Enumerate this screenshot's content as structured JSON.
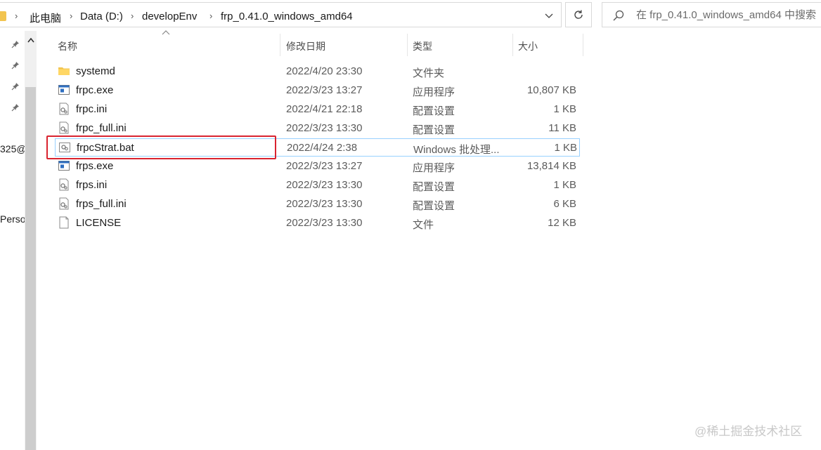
{
  "address": {
    "crumbs": [
      "此电脑",
      "Data (D:)",
      "developEnv",
      "frp_0.41.0_windows_amd64"
    ]
  },
  "search": {
    "placeholder": "在 frp_0.41.0_windows_amd64 中搜索"
  },
  "nav_pane": {
    "fragments": [
      "325@",
      "Perso"
    ]
  },
  "columns": {
    "name": "名称",
    "modified": "修改日期",
    "type": "类型",
    "size": "大小"
  },
  "files": [
    {
      "name": "systemd",
      "modified": "2022/4/20 23:30",
      "type": "文件夹",
      "size": "",
      "icon": "folder-icon"
    },
    {
      "name": "frpc.exe",
      "modified": "2022/3/23 13:27",
      "type": "应用程序",
      "size": "10,807 KB",
      "icon": "exe-icon"
    },
    {
      "name": "frpc.ini",
      "modified": "2022/4/21 22:18",
      "type": "配置设置",
      "size": "1 KB",
      "icon": "config-file-icon"
    },
    {
      "name": "frpc_full.ini",
      "modified": "2022/3/23 13:30",
      "type": "配置设置",
      "size": "11 KB",
      "icon": "config-file-icon"
    },
    {
      "name": "frpcStrat.bat",
      "modified": "2022/4/24 2:38",
      "type": "Windows 批处理...",
      "size": "1 KB",
      "icon": "batch-file-icon",
      "selected": true
    },
    {
      "name": "frps.exe",
      "modified": "2022/3/23 13:27",
      "type": "应用程序",
      "size": "13,814 KB",
      "icon": "exe-icon"
    },
    {
      "name": "frps.ini",
      "modified": "2022/3/23 13:30",
      "type": "配置设置",
      "size": "1 KB",
      "icon": "config-file-icon"
    },
    {
      "name": "frps_full.ini",
      "modified": "2022/3/23 13:30",
      "type": "配置设置",
      "size": "6 KB",
      "icon": "config-file-icon"
    },
    {
      "name": "LICENSE",
      "modified": "2022/3/23 13:30",
      "type": "文件",
      "size": "12 KB",
      "icon": "generic-file-icon"
    }
  ],
  "watermark": "@稀土掘金技术社区",
  "colors": {
    "highlight": "#d9232f",
    "selection_border": "#99d1ff",
    "folder": "#f2c44f"
  }
}
